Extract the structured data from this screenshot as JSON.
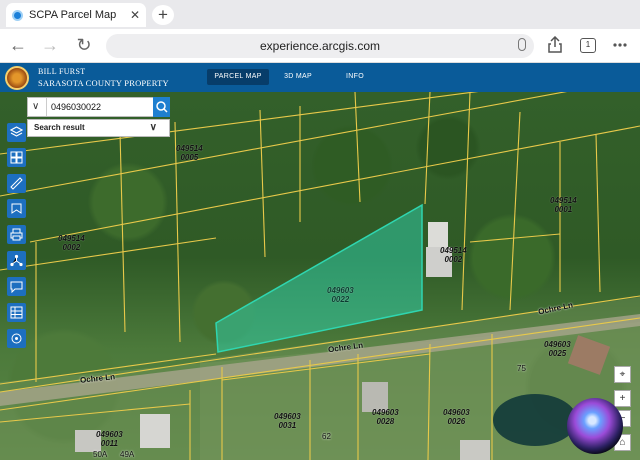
{
  "browser": {
    "tab_title": "SCPA Parcel Map",
    "tab_close": "✕",
    "new_tab": "+",
    "url": "experience.arcgis.com",
    "tab_count": "1",
    "back": "←",
    "forward": "→",
    "reload": "↻"
  },
  "app": {
    "brand_line1": "BILL FURST",
    "brand_line2": "SARASOTA COUNTY PROPERTY",
    "nav": [
      {
        "label": "PARCEL MAP",
        "active": true
      },
      {
        "label": "3D MAP",
        "active": false
      },
      {
        "label": "INFO",
        "active": false
      }
    ]
  },
  "search": {
    "value": "0496030022",
    "clear": "✕",
    "chevron": "∨",
    "result_label": "Search result",
    "result_chevron": "∨"
  },
  "tools": [
    "layers-icon",
    "basemap-icon",
    "measure-icon",
    "bookmark-icon",
    "print-icon",
    "share-icon",
    "feedback-icon",
    "table-icon",
    "coordinate-icon"
  ],
  "map": {
    "parcels": [
      {
        "line1": "049514",
        "line2": "0005"
      },
      {
        "line1": "049514",
        "line2": "0002"
      },
      {
        "line1": "049514",
        "line2": "0001"
      },
      {
        "line1": "049603",
        "line2": "0022"
      },
      {
        "line1": "049514",
        "line2": "0002"
      },
      {
        "line1": "049603",
        "line2": "0025"
      },
      {
        "line1": "049603",
        "line2": "0031"
      },
      {
        "line1": "049603",
        "line2": "0028"
      },
      {
        "line1": "049603",
        "line2": "0026"
      },
      {
        "line1": "049603",
        "line2": "0011"
      }
    ],
    "roads": [
      "Ochre Ln",
      "Ochre Ln",
      "Ochre Ln"
    ],
    "addresses": [
      "50A",
      "49A",
      "75",
      "62"
    ],
    "highlight_color": "#2fd6b0",
    "boundary_color": "#e8c94a"
  },
  "controls": {
    "locate": "⌖",
    "zoom_in": "+",
    "zoom_out": "−",
    "home": "⌂"
  }
}
